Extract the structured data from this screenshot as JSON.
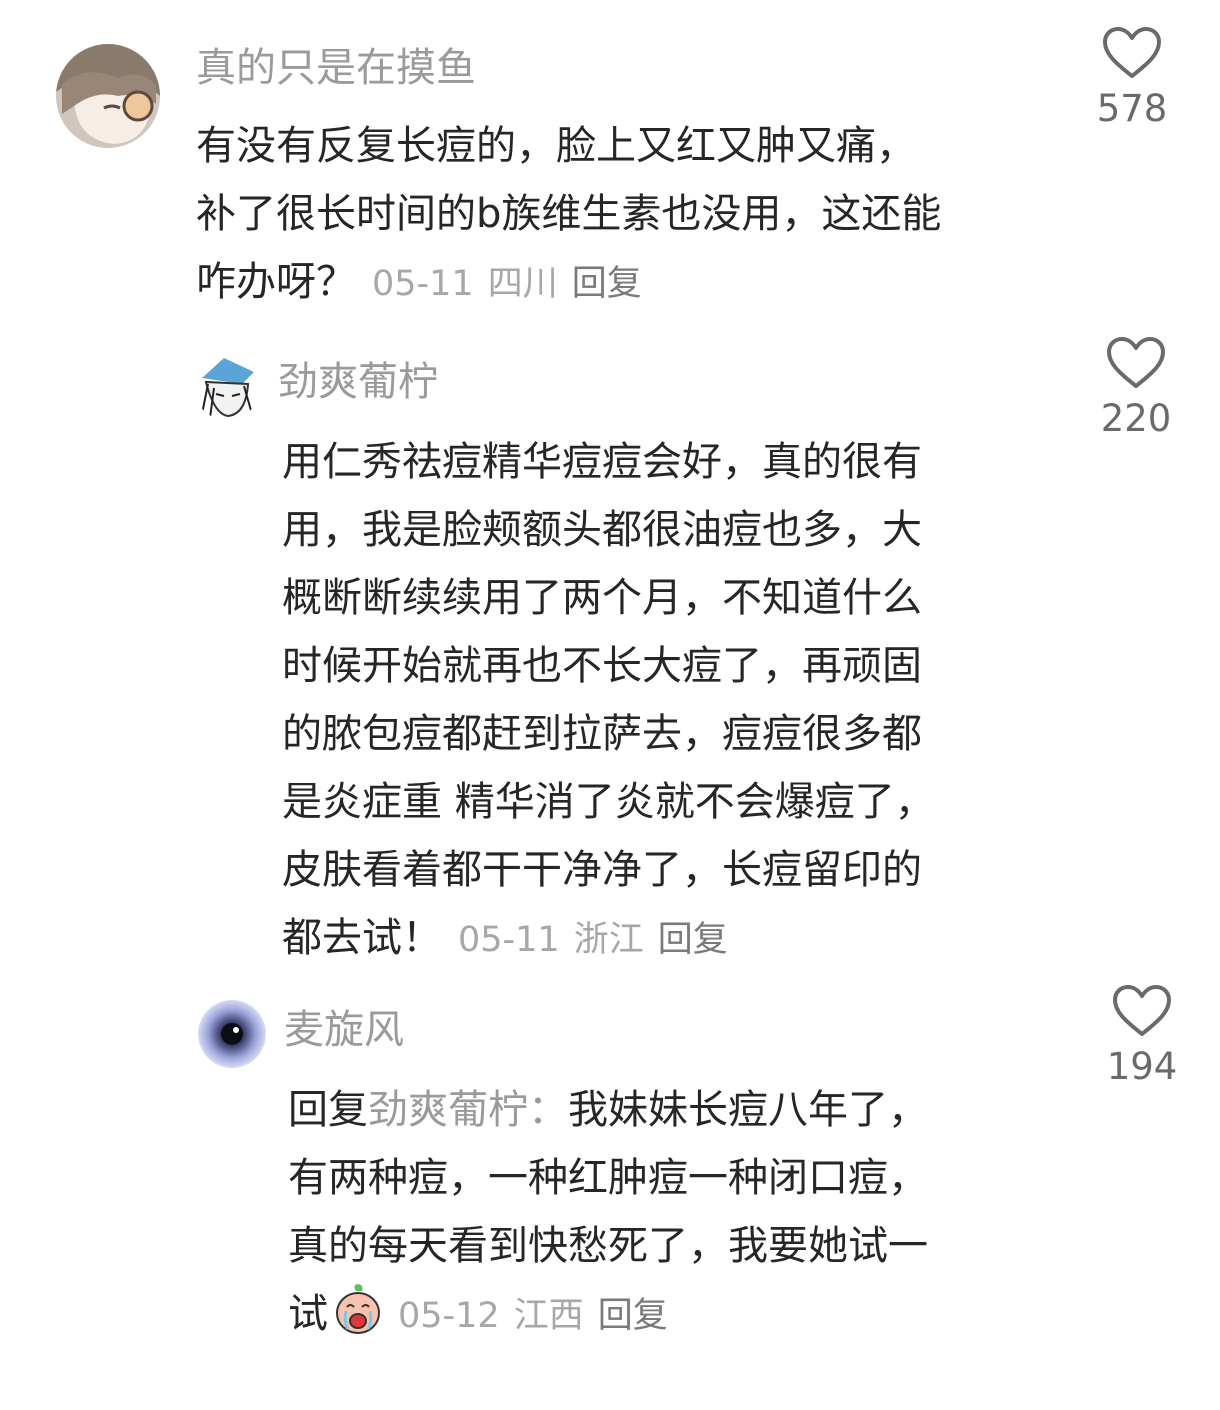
{
  "comments": [
    {
      "username": "真的只是在摸鱼",
      "lines": [
        "有没有反复长痘的，脸上又红又肿又痛，",
        "补了很长时间的b族维生素也没用，这还能",
        "咋办呀？"
      ],
      "date": "05-11",
      "location": "四川",
      "reply_label": "回复",
      "likes": "578"
    },
    {
      "username": "劲爽葡柠",
      "lines": [
        "用仁秀祛痘精华痘痘会好，真的很有",
        "用，我是脸颊额头都很油痘也多，大",
        "概断断续续用了两个月，不知道什么",
        "时候开始就再也不长大痘了，再顽固",
        "的脓包痘都赶到拉萨去，痘痘很多都",
        "是炎症重 精华消了炎就不会爆痘了，",
        "皮肤看着都干干净净了，长痘留印的",
        "都去试！"
      ],
      "date": "05-11",
      "location": "浙江",
      "reply_label": "回复",
      "likes": "220"
    },
    {
      "username": "麦旋风",
      "reply_prefix": "回复",
      "mention": "劲爽葡柠",
      "mention_sep": "：",
      "lines": [
        "我妹妹长痘八年了，",
        "有两种痘，一种红肿痘一种闭口痘，",
        "真的每天看到快愁死了，我要她试一",
        "试"
      ],
      "emoji": "crying-peach-emoji",
      "date": "05-12",
      "location": "江西",
      "reply_label": "回复",
      "likes": "194"
    }
  ],
  "colors": {
    "text": "#262626",
    "username": "#9a9a9a",
    "meta": "#a7a7a7",
    "icon": "#6a6a6a"
  }
}
